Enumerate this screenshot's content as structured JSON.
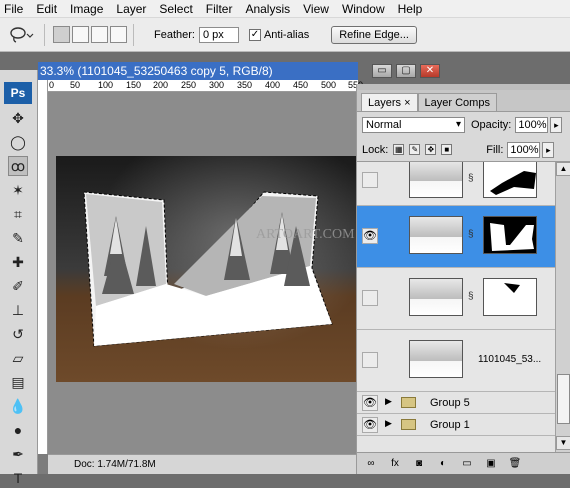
{
  "menu": [
    "File",
    "Edit",
    "Image",
    "Layer",
    "Select",
    "Filter",
    "Analysis",
    "View",
    "Window",
    "Help"
  ],
  "options": {
    "feather_label": "Feather:",
    "feather_value": "0 px",
    "antialias_label": "Anti-alias",
    "antialias_checked": "✓",
    "refine_label": "Refine Edge..."
  },
  "toolbox": {
    "logo": "Ps"
  },
  "document": {
    "title": "33.3% (1101045_53250463 copy 5, RGB/8)",
    "ruler_ticks": [
      "0",
      "50",
      "100",
      "150",
      "200",
      "250",
      "300",
      "350",
      "400",
      "450",
      "500",
      "550"
    ],
    "watermark": "ARTOART.COM",
    "status": "Doc: 1.74M/71.8M"
  },
  "window_controls": {
    "minimize": "▭",
    "restore": "▢",
    "close": "✕"
  },
  "layers_panel": {
    "tabs": [
      "Layers",
      "Layer Comps"
    ],
    "close_tab": "×",
    "blend_mode": "Normal",
    "opacity_label": "Opacity:",
    "opacity_value": "100%",
    "lock_label": "Lock:",
    "fill_label": "Fill:",
    "fill_value": "100%",
    "layers": [
      {
        "name": "",
        "visible": false,
        "selected": false
      },
      {
        "name": "",
        "visible": true,
        "selected": true
      },
      {
        "name": "",
        "visible": false,
        "selected": false
      },
      {
        "name": "1101045_53...",
        "visible": false,
        "selected": false
      }
    ],
    "groups": [
      "Group 5",
      "Group 1"
    ],
    "eye": "👁",
    "accent": "#3d8fe6"
  }
}
